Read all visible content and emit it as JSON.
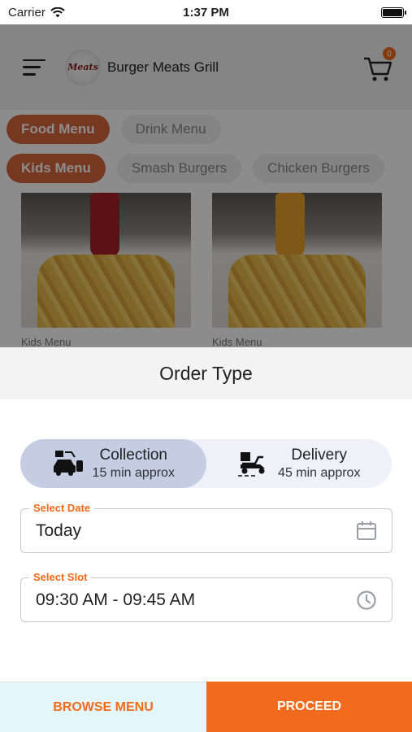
{
  "status_bar": {
    "carrier": "Carrier",
    "time": "1:37 PM"
  },
  "header": {
    "store_name": "Burger Meats Grill",
    "logo_text": "Meats",
    "cart_count": "0"
  },
  "categories": {
    "row1": [
      {
        "label": "Food Menu",
        "active": true
      },
      {
        "label": "Drink Menu",
        "active": false
      }
    ],
    "row2": [
      {
        "label": "Kids Menu",
        "active": true
      },
      {
        "label": "Smash Burgers",
        "active": false
      },
      {
        "label": "Chicken Burgers",
        "active": false
      }
    ]
  },
  "products": [
    {
      "category": "Kids Menu"
    },
    {
      "category": "Kids Menu"
    }
  ],
  "order_type": {
    "title": "Order Type",
    "options": [
      {
        "title": "Collection",
        "subtitle": "15 min approx",
        "selected": true,
        "icon": "collection-car-icon"
      },
      {
        "title": "Delivery",
        "subtitle": "45 min approx",
        "selected": false,
        "icon": "delivery-scooter-icon"
      }
    ],
    "date_field": {
      "label": "Select Date",
      "value": "Today",
      "icon": "calendar-icon"
    },
    "slot_field": {
      "label": "Select Slot",
      "value": "09:30 AM - 09:45 AM",
      "icon": "clock-icon"
    }
  },
  "actions": {
    "browse_label": "BROWSE MENU",
    "proceed_label": "PROCEED"
  },
  "colors": {
    "accent": "#f26a1b",
    "selected_option": "#c5cde3",
    "browse_bg": "#e3f6f9"
  }
}
